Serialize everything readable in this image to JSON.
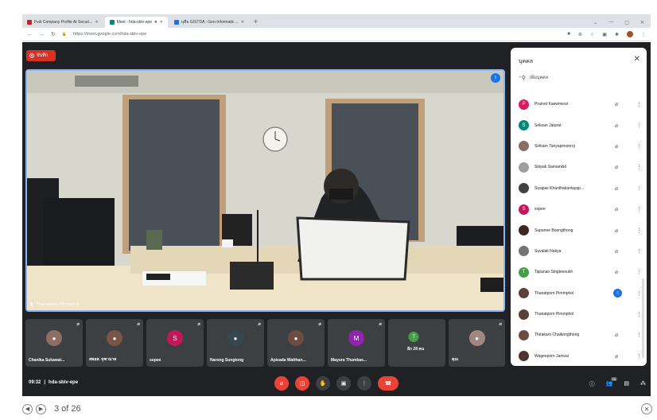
{
  "browser": {
    "tabs": [
      {
        "title": "Fvdi Company Profile At Securi...",
        "favicon_color": "#c5221f",
        "active": false
      },
      {
        "title": "Meet - hda-sbiv-epe",
        "favicon_color": "#00897b",
        "active": true
      },
      {
        "title": "บุคือ GISTDA : Geo-Informatic ...",
        "favicon_color": "#1a73e8",
        "active": false
      }
    ],
    "new_tab": "+",
    "url": "https://meet.google.com/hda-sbiv-epe"
  },
  "meet": {
    "record_label": "บันทึก",
    "main_speaker": "Thanatporn Pimmphol",
    "meeting_time": "09:32",
    "meeting_code": "hda-sbiv-epe",
    "participant_count": "26",
    "tiles": [
      {
        "name": "Chanika Sukawat...",
        "avatar": "photo",
        "letter": "",
        "color": "#8d6e63"
      },
      {
        "name": "สพอส. จุฑามาส",
        "avatar": "photo",
        "letter": "",
        "color": "#795548"
      },
      {
        "name": "sopee",
        "avatar": "letter",
        "letter": "S",
        "color": "#c2185b"
      },
      {
        "name": "Narong Sungtong",
        "avatar": "photo",
        "letter": "",
        "color": "#37474f"
      },
      {
        "name": "Apisada Watthan...",
        "avatar": "photo",
        "letter": "",
        "color": "#6d4c41"
      },
      {
        "name": "Mayura Thumkae...",
        "avatar": "letter",
        "letter": "M",
        "color": "#8e24aa"
      },
      {
        "name": "อีก 28 คน",
        "avatar": "group",
        "letter": "T",
        "color": "#43a047"
      },
      {
        "name": "คุณ",
        "avatar": "photo",
        "letter": "",
        "color": "#a1887f"
      }
    ]
  },
  "panel": {
    "title": "บุคคล",
    "add_people": "เพิ่มบุคคล",
    "people": [
      {
        "name": "Pramet Kaewmesri",
        "letter": "P",
        "color": "#d81b60",
        "speaking": false
      },
      {
        "name": "Seksan Jaturat",
        "letter": "S",
        "color": "#00897b",
        "speaking": false
      },
      {
        "name": "Sirikarn Tanyapimonroj",
        "letter": "",
        "color": "#8d6e63",
        "speaking": false
      },
      {
        "name": "Siripak Samiankid",
        "letter": "",
        "color": "#9e9e9e",
        "speaking": false
      },
      {
        "name": "Siyapas Khanthakanlayap...",
        "letter": "",
        "color": "#424242",
        "speaking": false
      },
      {
        "name": "sopee",
        "letter": "S",
        "color": "#c2185b",
        "speaking": false
      },
      {
        "name": "Supanee Boongthong",
        "letter": "",
        "color": "#3e2723",
        "speaking": false
      },
      {
        "name": "Suvalak Nakya",
        "letter": "",
        "color": "#757575",
        "speaking": false
      },
      {
        "name": "Tapanan Singteesukh",
        "letter": "T",
        "color": "#43a047",
        "speaking": false
      },
      {
        "name": "Thanatporn Pimmphol",
        "letter": "",
        "color": "#5d4037",
        "speaking": true
      },
      {
        "name": "Thanatporn Pimmphol",
        "letter": "",
        "color": "#5d4037",
        "speaking": false
      },
      {
        "name": "Thirakarn Chaikongthong",
        "letter": "",
        "color": "#6d4c41",
        "speaking": false
      },
      {
        "name": "Wageeporn Jamvai",
        "letter": "",
        "color": "#4e342e",
        "speaking": false
      }
    ]
  },
  "viewer": {
    "page_info": "3 of 26"
  }
}
